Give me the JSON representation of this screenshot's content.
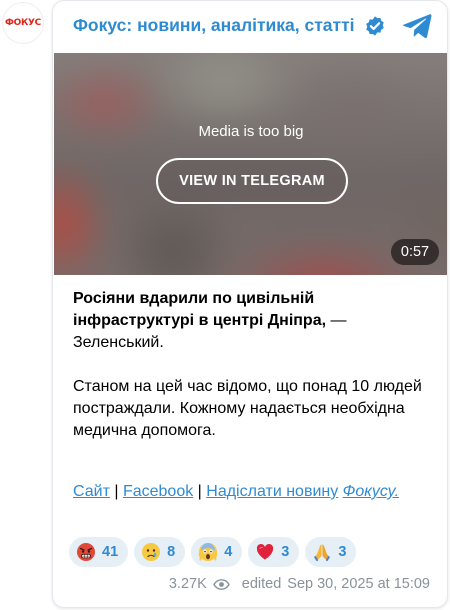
{
  "channel": {
    "avatar_text": "ФОКУС",
    "title": "Фокус: новини, аналітика, статті",
    "verified_icon": "verified-badge-icon",
    "telegram_icon": "telegram-logo-icon",
    "accent_color": "#2f8bd1"
  },
  "media": {
    "notice": "Media is too big",
    "button_label": "VIEW IN TELEGRAM",
    "duration": "0:57"
  },
  "post": {
    "headline": "Росіяни вдарили по цивільній інфраструктурі в центрі Дніпра,",
    "headline_suffix": " — Зеленський.",
    "body": "Станом на цей час відомо, що понад 10 людей постраждали. Кожному надається необхідна медична допомога."
  },
  "links": {
    "site": "Сайт",
    "separator": " | ",
    "facebook": "Facebook",
    "submit_news": "Надіслати новину",
    "focus": "Фокусу."
  },
  "reactions": [
    {
      "icon": "angry-face-icon",
      "count": "41"
    },
    {
      "icon": "crying-face-icon",
      "count": "8"
    },
    {
      "icon": "screaming-face-icon",
      "count": "4"
    },
    {
      "icon": "red-heart-icon",
      "count": "3"
    },
    {
      "icon": "folded-hands-icon",
      "count": "3"
    }
  ],
  "meta": {
    "views": "3.27K",
    "eye_icon": "eye-icon",
    "edited_label": "edited",
    "timestamp": "Sep 30, 2025 at 15:09"
  }
}
